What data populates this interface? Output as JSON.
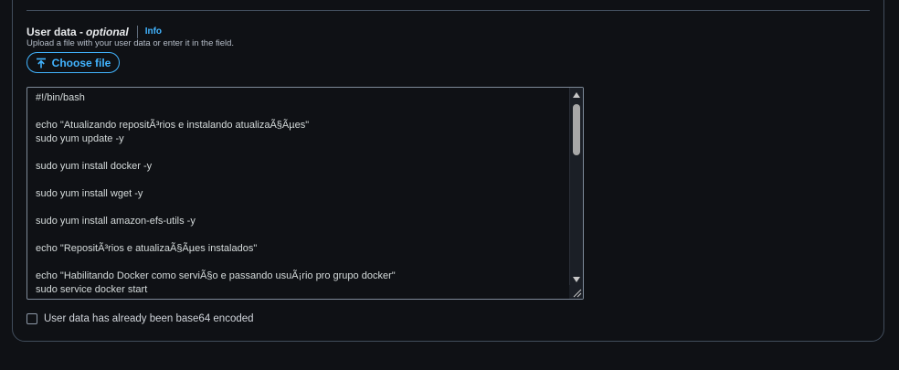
{
  "user_data": {
    "label": "User data -",
    "optional": "optional",
    "info": "Info",
    "description": "Upload a file with your user data or enter it in the field.",
    "choose_file": "Choose file",
    "code_lines": [
      "#!/bin/bash",
      "",
      "echo \"Atualizando repositÃ³rios e instalando atualizaÃ§Ãµes\"",
      "sudo yum update -y",
      "",
      "sudo yum install docker -y",
      "",
      "sudo yum install wget -y",
      "",
      "sudo yum install amazon-efs-utils -y",
      "",
      "echo \"RepositÃ³rios e atualizaÃ§Ãµes instalados\"",
      "",
      "echo \"Habilitando Docker como serviÃ§o e passando usuÃ¡rio pro grupo docker\"",
      "sudo service docker start"
    ],
    "base64_checkbox_label": "User data has already been base64 encoded"
  },
  "colors": {
    "accent": "#42b4ff",
    "border": "#414d5c",
    "background": "#0f1115"
  }
}
